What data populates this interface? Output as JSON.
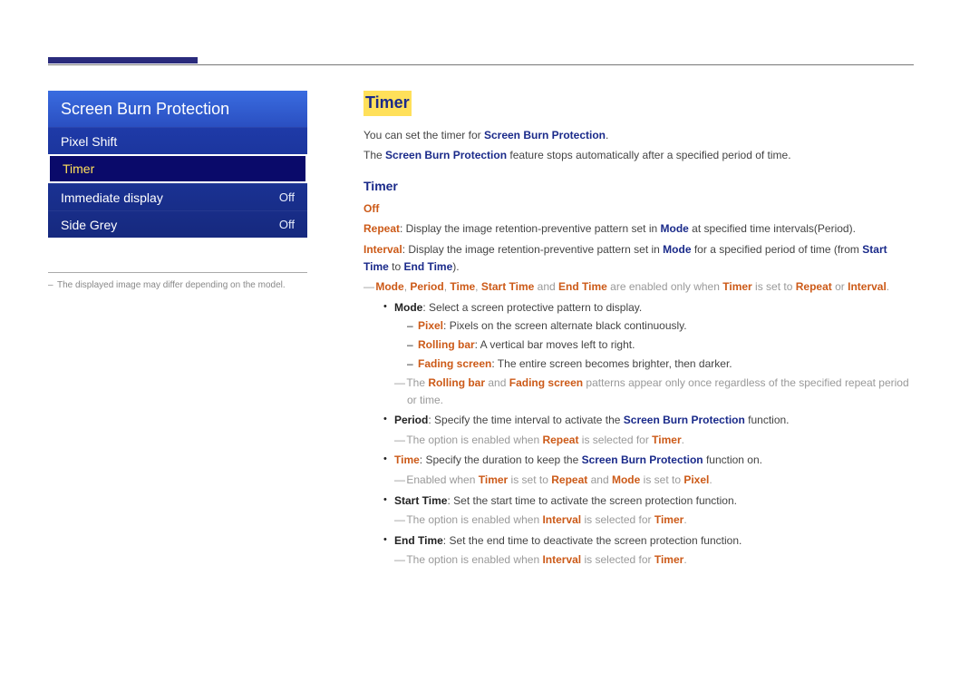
{
  "osd": {
    "title": "Screen Burn Protection",
    "items": [
      {
        "label": "Pixel Shift",
        "value": ""
      },
      {
        "label": "Timer",
        "value": ""
      },
      {
        "label": "Immediate display",
        "value": "Off"
      },
      {
        "label": "Side Grey",
        "value": "Off"
      }
    ]
  },
  "footnote": "The displayed image may differ depending on the model.",
  "section": {
    "heading": "Timer",
    "intro1_a": "You can set the timer for ",
    "intro1_b": "Screen Burn Protection",
    "intro1_c": ".",
    "intro2_a": "The ",
    "intro2_b": "Screen Burn Protection",
    "intro2_c": " feature stops automatically after a specified period of time.",
    "subheading": "Timer",
    "off_label": "Off",
    "repeat_a": "Repeat",
    "repeat_b": ": Display the image retention-preventive pattern set in ",
    "repeat_c": "Mode",
    "repeat_d": " at specified time intervals(Period).",
    "interval_a": "Interval",
    "interval_b": ": Display the image retention-preventive pattern set in ",
    "interval_c": "Mode",
    "interval_d": " for a specified period of time (from ",
    "interval_e": "Start Time",
    "interval_f": " to ",
    "interval_g": "End Time",
    "interval_h": ").",
    "note1_a": "Mode",
    "note1_b": ", ",
    "note1_c": "Period",
    "note1_d": ", ",
    "note1_e": "Time",
    "note1_f": ", ",
    "note1_g": "Start Time",
    "note1_h": " and ",
    "note1_i": "End Time",
    "note1_j": " are enabled only when ",
    "note1_k": "Timer",
    "note1_l": " is set to ",
    "note1_m": "Repeat",
    "note1_n": " or ",
    "note1_o": "Interval",
    "note1_p": ".",
    "mode_a": "Mode",
    "mode_b": ": Select a screen protective pattern to display.",
    "pixel_a": "Pixel",
    "pixel_b": ": Pixels on the screen alternate black continuously.",
    "rolling_a": "Rolling bar",
    "rolling_b": ": A vertical bar moves left to right.",
    "fading_a": "Fading screen",
    "fading_b": ": The entire screen becomes brighter, then darker.",
    "note2_a": "The ",
    "note2_b": "Rolling bar",
    "note2_c": " and ",
    "note2_d": "Fading screen",
    "note2_e": " patterns appear only once regardless of the specified repeat period or time.",
    "period_a": "Period",
    "period_b": ": Specify the time interval to activate the ",
    "period_c": "Screen Burn Protection",
    "period_d": " function.",
    "note3_a": "The option is enabled when ",
    "note3_b": "Repeat",
    "note3_c": " is selected for ",
    "note3_d": "Timer",
    "note3_e": ".",
    "time_a": "Time",
    "time_b": ": Specify the duration to keep the ",
    "time_c": "Screen Burn Protection",
    "time_d": " function on.",
    "note4_a": "Enabled when ",
    "note4_b": "Timer",
    "note4_c": " is set to ",
    "note4_d": "Repeat",
    "note4_e": " and ",
    "note4_f": "Mode",
    "note4_g": " is set to ",
    "note4_h": "Pixel",
    "note4_i": ".",
    "start_a": "Start Time",
    "start_b": ": Set the start time to activate the screen protection function.",
    "note5_a": "The option is enabled when ",
    "note5_b": "Interval",
    "note5_c": " is selected for ",
    "note5_d": "Timer",
    "note5_e": ".",
    "end_a": "End Time",
    "end_b": ": Set the end time to deactivate the screen protection function.",
    "note6_a": "The option is enabled when ",
    "note6_b": "Interval",
    "note6_c": " is selected for ",
    "note6_d": "Timer",
    "note6_e": "."
  }
}
